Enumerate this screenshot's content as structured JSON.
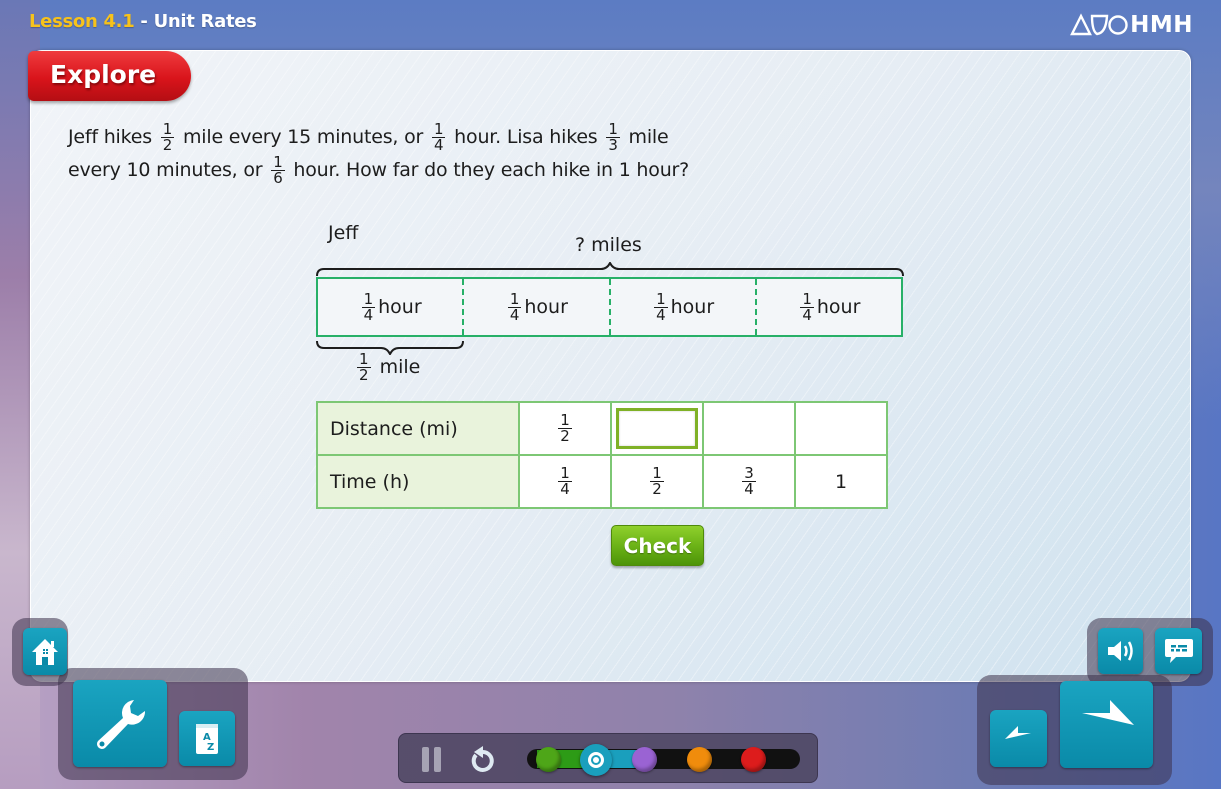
{
  "header": {
    "lesson_label": "Lesson 4.1",
    "separator": " - ",
    "title": "Unit Rates",
    "brand": "HMH",
    "lesson_color": "#f7c21b"
  },
  "section_tab": {
    "label": "Explore",
    "color": "#d9141b"
  },
  "problem": {
    "line1": {
      "t1": "Jeff hikes",
      "f1": {
        "num": "1",
        "den": "2"
      },
      "t2": "mile every 15 minutes, or",
      "f2": {
        "num": "1",
        "den": "4"
      },
      "t3": "hour. Lisa hikes",
      "f3": {
        "num": "1",
        "den": "3"
      },
      "t4": "mile"
    },
    "line2": {
      "t1": "every 10 minutes, or",
      "f1": {
        "num": "1",
        "den": "6"
      },
      "t2": "hour. How far do they each hike in 1 hour?"
    }
  },
  "diagram": {
    "name_label": "Jeff",
    "total_label": "? miles",
    "segments": [
      {
        "num": "1",
        "den": "4",
        "unit": "hour"
      },
      {
        "num": "1",
        "den": "4",
        "unit": "hour"
      },
      {
        "num": "1",
        "den": "4",
        "unit": "hour"
      },
      {
        "num": "1",
        "den": "4",
        "unit": "hour"
      }
    ],
    "segment_label": {
      "num": "1",
      "den": "2",
      "unit": "mile"
    },
    "border_color": "#27b068"
  },
  "rate_table": {
    "rows": [
      {
        "header": "Distance (mi)",
        "cells": [
          {
            "num": "1",
            "den": "2"
          },
          {
            "input": true,
            "value": "",
            "placeholder": ""
          },
          {
            "text": ""
          },
          {
            "text": ""
          }
        ]
      },
      {
        "header": "Time (h)",
        "cells": [
          {
            "num": "1",
            "den": "4"
          },
          {
            "num": "1",
            "den": "2"
          },
          {
            "num": "3",
            "den": "4"
          },
          {
            "text": "1"
          }
        ]
      }
    ]
  },
  "check_button": {
    "label": "Check",
    "color": "#6cb317"
  },
  "left_dock": {
    "home": {
      "icon": "home-icon"
    },
    "tools": {
      "icon": "wrench-icon"
    },
    "glossary": {
      "icon": "glossary-az-icon",
      "letters": "A Z"
    }
  },
  "right_dock": {
    "audio": {
      "icon": "speaker-icon"
    },
    "captions": {
      "icon": "caption-icon"
    },
    "back": {
      "icon": "arrow-left-icon"
    },
    "next": {
      "icon": "arrow-right-icon"
    }
  },
  "media_bar": {
    "pause": {
      "icon": "pause-icon"
    },
    "replay": {
      "icon": "replay-icon"
    },
    "steps": [
      {
        "name": "step-1",
        "color": "#4ea618",
        "state": "completed"
      },
      {
        "name": "step-2",
        "color": "#1a9fbd",
        "state": "current"
      },
      {
        "name": "step-3",
        "color": "#9a63d3",
        "state": "upcoming"
      },
      {
        "name": "step-4",
        "color": "#f08c0c",
        "state": "upcoming"
      },
      {
        "name": "step-5",
        "color": "#dd1c1c",
        "state": "upcoming"
      }
    ],
    "current_step": 2,
    "total_steps": 5
  }
}
